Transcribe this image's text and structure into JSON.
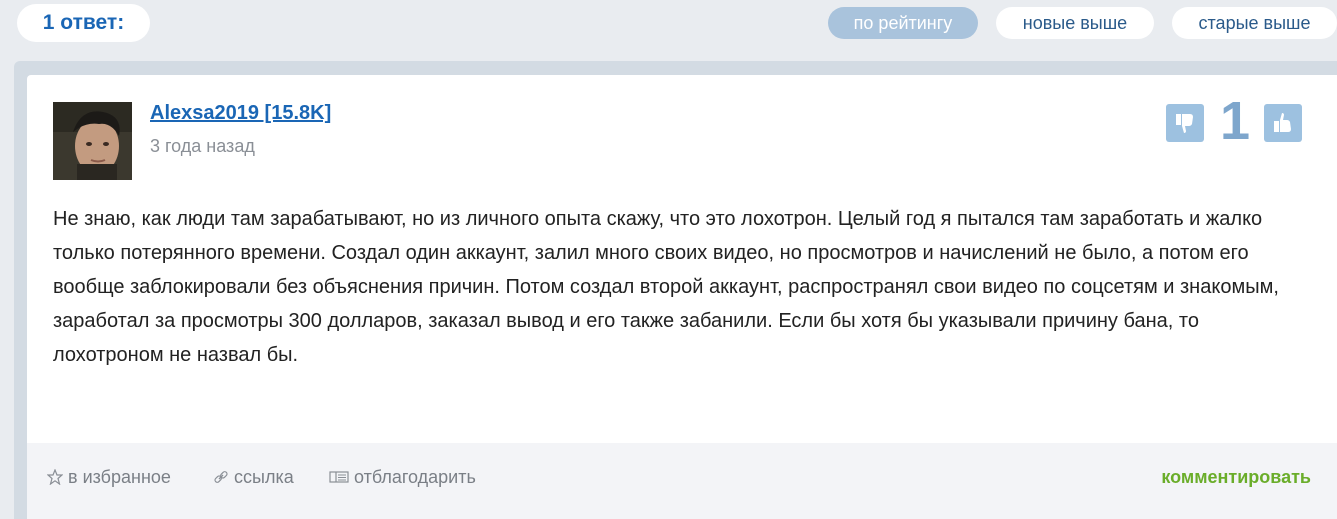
{
  "header": {
    "answers_label": "1 ответ:",
    "sort": {
      "by_rating": "по рейтингу",
      "newest": "новые выше",
      "oldest": "старые выше"
    }
  },
  "answer": {
    "author": "Alexsa2019 [15.8K]",
    "time_ago": "3 года назад",
    "score": "1",
    "text": "Не знаю, как люди там зарабатывают, но из личного опыта скажу, что это лохотрон. Целый год я пытался там заработать и жалко только потерянного времени. Создал один аккаунт, залил много своих видео, но просмотров и начислений не было, а потом его вообще заблокировали без объяснения причин. Потом создал второй аккаунт, распространял свои видео по соцсетям и знакомым, заработал за просмотры 300 долларов, заказал вывод и его также забанили. Если бы хотя бы указывали причину бана, то лохотроном не назвал бы.",
    "footer": {
      "favorite": "в избранное",
      "link": "ссылка",
      "thank": "отблагодарить",
      "comment": "комментировать"
    }
  },
  "colors": {
    "link_blue": "#1a66b5",
    "active_sort": "#a9c3dc",
    "vote_button": "#9dc1e0",
    "comment_green": "#6aad2a"
  }
}
